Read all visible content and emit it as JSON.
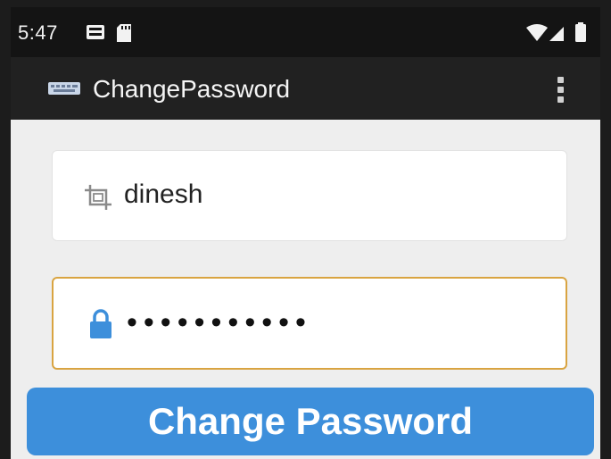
{
  "status_bar": {
    "time": "5:47",
    "left_icons": [
      "notification-icon",
      "sd-card-icon"
    ],
    "right_icons": [
      "wifi-icon",
      "signal-icon",
      "battery-icon"
    ]
  },
  "app_bar": {
    "title": "ChangePassword",
    "app_icon": "keyboard-icon",
    "menu_icon": "more-vert-icon"
  },
  "form": {
    "username": {
      "value": "dinesh",
      "icon": "crop-icon"
    },
    "password": {
      "value": "•••••••••••",
      "icon": "lock-icon",
      "focused": true
    },
    "submit_label": "Change Password"
  },
  "colors": {
    "status_bar_bg": "#141414",
    "app_bar_bg": "#212121",
    "screen_bg": "#eeeeee",
    "focus_border": "#d9a441",
    "button_bg": "#3d8fdb",
    "lock_icon": "#3d8fdb"
  }
}
